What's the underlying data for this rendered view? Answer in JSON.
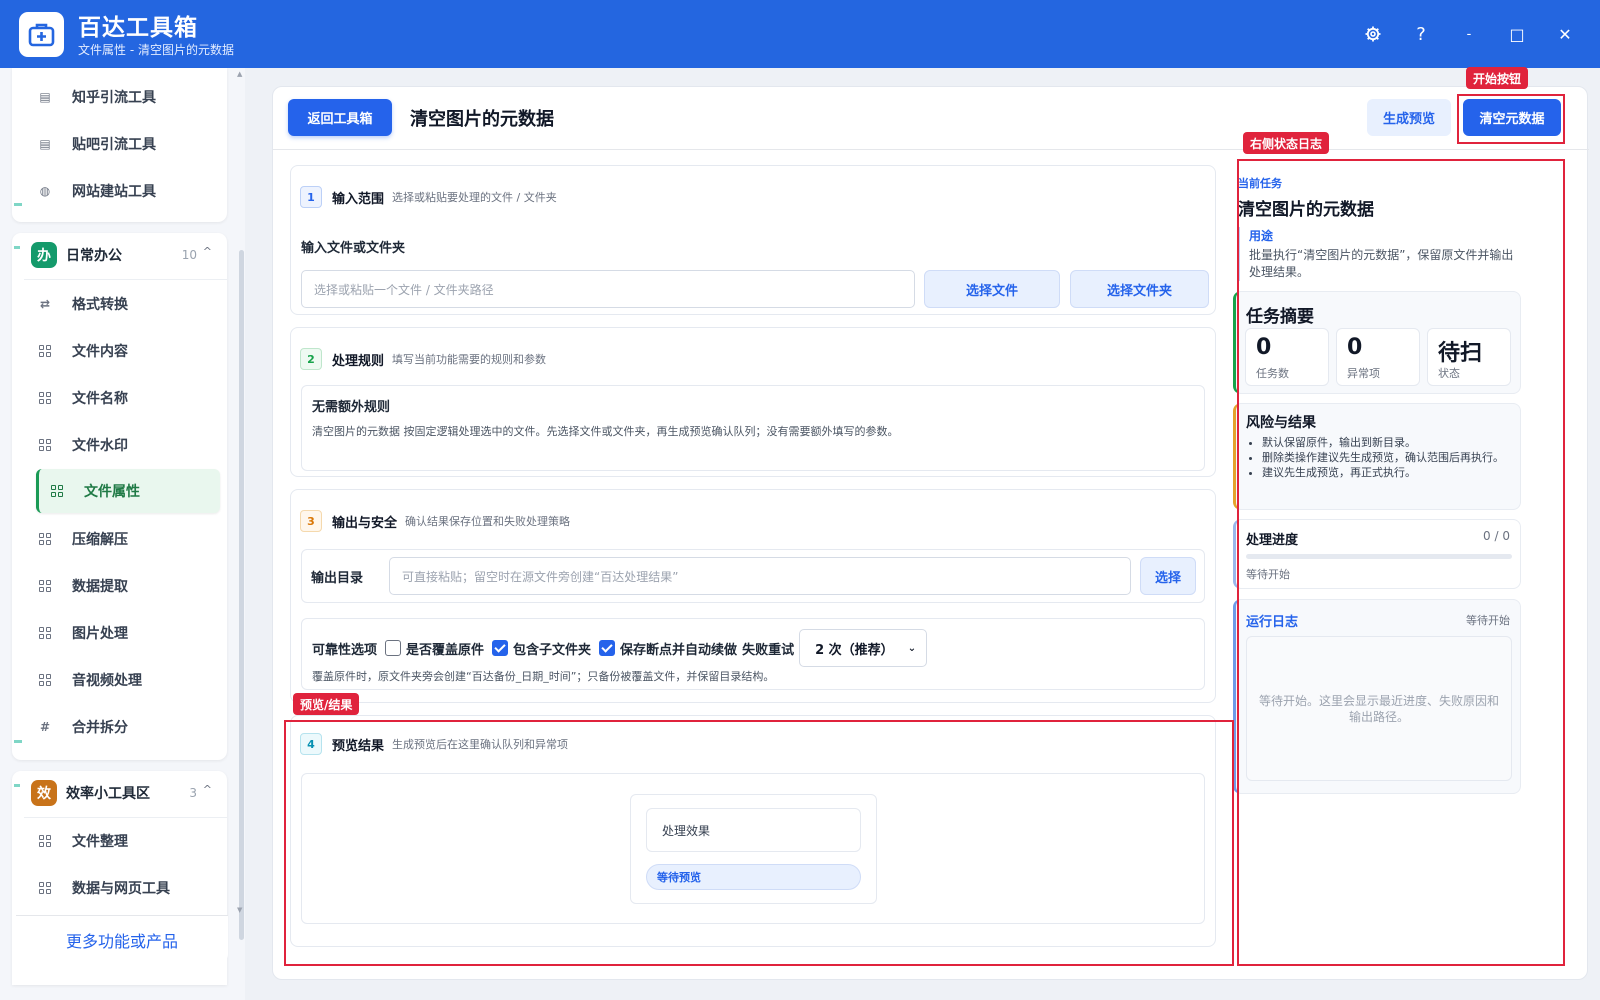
{
  "window": {
    "title": "百达工具箱",
    "subtitle": "文件属性 - 清空图片的元数据",
    "settings_icon": "gear-icon",
    "help_label": "?",
    "minimize_label": "-",
    "maximize_label": "□",
    "close_label": "✕"
  },
  "sidebar": {
    "top_items": [
      {
        "label": "知乎引流工具",
        "icon": "doc-icon"
      },
      {
        "label": "贴吧引流工具",
        "icon": "doc-icon"
      },
      {
        "label": "网站建站工具",
        "icon": "globe-icon"
      }
    ],
    "groups": [
      {
        "badge": "办",
        "name": "日常办公",
        "count": "10",
        "caret": "^",
        "color": "#149a6b",
        "items": [
          {
            "label": "格式转换",
            "icon": "swap-icon"
          },
          {
            "label": "文件内容",
            "icon": "grid-icon"
          },
          {
            "label": "文件名称",
            "icon": "grid-icon"
          },
          {
            "label": "文件水印",
            "icon": "grid-icon"
          },
          {
            "label": "文件属性",
            "icon": "grid-icon",
            "active": true
          },
          {
            "label": "压缩解压",
            "icon": "grid-icon"
          },
          {
            "label": "数据提取",
            "icon": "grid-icon"
          },
          {
            "label": "图片处理",
            "icon": "grid-icon"
          },
          {
            "label": "音视频处理",
            "icon": "grid-icon"
          },
          {
            "label": "合并拆分",
            "icon": "hash-icon"
          }
        ]
      },
      {
        "badge": "效",
        "name": "效率小工具区",
        "count": "3",
        "caret": "^",
        "color": "#c8731a",
        "items": [
          {
            "label": "文件整理",
            "icon": "grid-icon"
          },
          {
            "label": "数据与网页工具",
            "icon": "grid-icon"
          }
        ]
      }
    ],
    "more_link": "更多功能或产品"
  },
  "header": {
    "back_button": "返回工具箱",
    "title": "清空图片的元数据",
    "preview_button": "生成预览",
    "start_button": "清空元数据"
  },
  "sections": {
    "input": {
      "num": "1",
      "title": "输入范围",
      "desc": "选择或粘贴要处理的文件 / 文件夹",
      "field_label": "输入文件或文件夹",
      "placeholder": "选择或粘贴一个文件 / 文件夹路径",
      "select_file": "选择文件",
      "select_folder": "选择文件夹"
    },
    "rules": {
      "num": "2",
      "title": "处理规则",
      "desc": "填写当前功能需要的规则和参数",
      "box_title": "无需额外规则",
      "box_text": "清空图片的元数据 按固定逻辑处理选中的文件。先选择文件或文件夹，再生成预览确认队列；没有需要额外填写的参数。"
    },
    "output": {
      "num": "3",
      "title": "输出与安全",
      "desc": "确认结果保存位置和失败处理策略",
      "dir_label": "输出目录",
      "dir_placeholder": "可直接粘贴；留空时在源文件旁创建“百达处理结果”",
      "choose": "选择",
      "reliability_label": "可靠性选项",
      "overwrite_label": "是否覆盖原件",
      "overwrite_checked": false,
      "subfolder_label": "包含子文件夹",
      "subfolder_checked": true,
      "resume_label": "保存断点并自动续做",
      "resume_checked": true,
      "retry_label": "失败重试",
      "retry_value": "2 次（推荐）",
      "note": "覆盖原件时，原文件夹旁会创建“百达备份_日期_时间”；只备份被覆盖文件，并保留目录结构。"
    },
    "preview": {
      "num": "4",
      "title": "预览结果",
      "desc": "生成预览后在这里确认队列和异常项",
      "effect_label": "处理效果",
      "waiting_label": "等待预览"
    }
  },
  "right_panel": {
    "current_task_label": "当前任务",
    "task_name": "清空图片的元数据",
    "usage_label": "用途",
    "usage_text": "批量执行“清空图片的元数据”，保留原文件并输出处理结果。",
    "summary_title": "任务摘要",
    "stats": [
      {
        "value": "0",
        "label": "任务数"
      },
      {
        "value": "0",
        "label": "异常项"
      },
      {
        "value": "待扫",
        "label": "状态"
      }
    ],
    "risk_title": "风险与结果",
    "risks": [
      "默认保留原件，输出到新目录。",
      "删除类操作建议先生成预览，确认范围后再执行。",
      "建议先生成预览，再正式执行。"
    ],
    "progress_title": "处理进度",
    "progress_value": "0 / 0",
    "progress_fraction": 0,
    "progress_status": "等待开始",
    "log_title": "运行日志",
    "log_status": "等待开始",
    "log_placeholder": "等待开始。这里会显示最近进度、失败原因和输出路径。"
  },
  "annotations": {
    "start_button_tag": "开始按钮",
    "right_log_tag": "右侧状态日志",
    "preview_tag": "预览/结果"
  },
  "colors": {
    "titlebar": "#2466e0",
    "primary": "#2563eb",
    "annotation": "#e0233c",
    "active_green": "#1a9a55"
  }
}
